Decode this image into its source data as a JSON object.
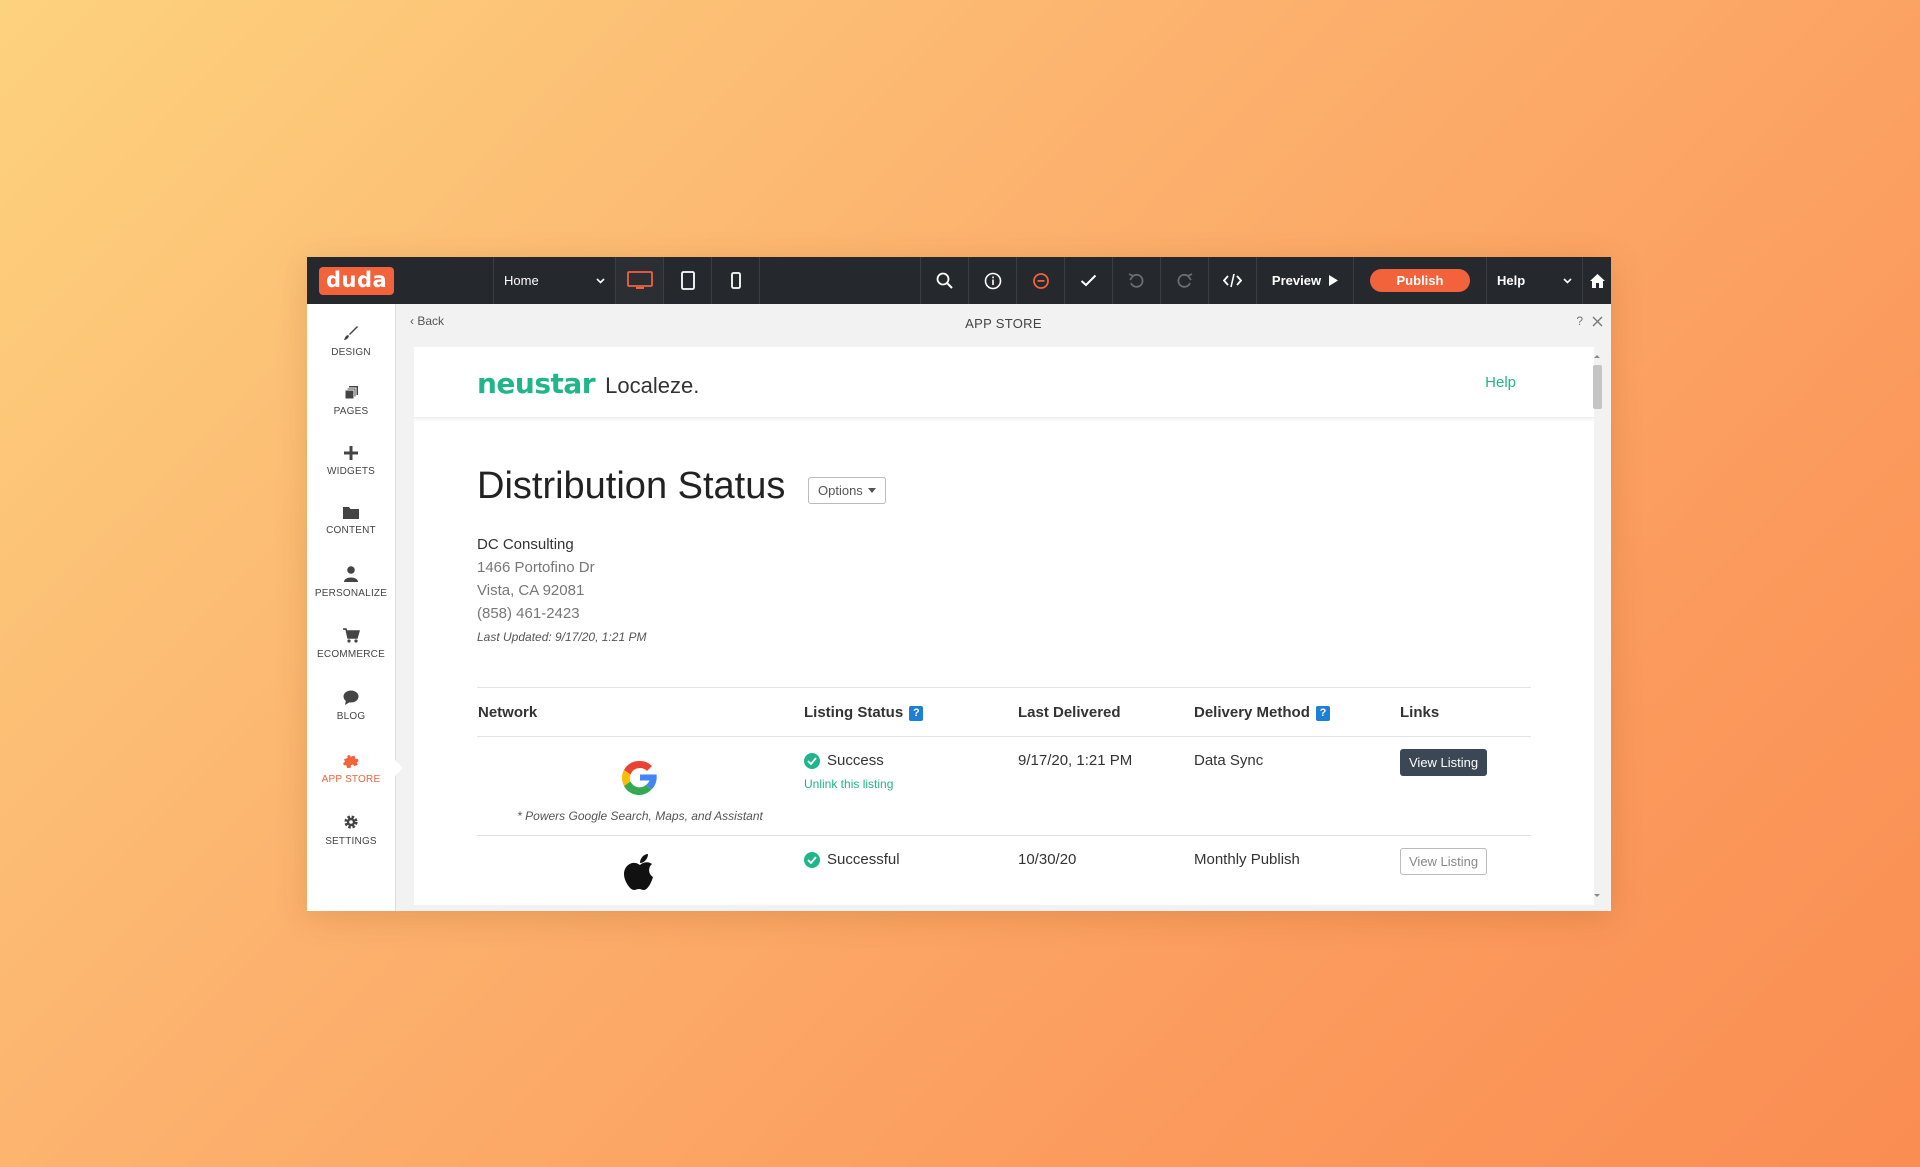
{
  "app": {
    "logo": "duda",
    "page_select": "Home",
    "toolbar": {
      "preview_label": "Preview",
      "publish_label": "Publish",
      "help_label": "Help"
    }
  },
  "sidebar": {
    "items": [
      {
        "label": "DESIGN",
        "icon": "brush-icon"
      },
      {
        "label": "PAGES",
        "icon": "pages-icon"
      },
      {
        "label": "WIDGETS",
        "icon": "plus-icon"
      },
      {
        "label": "CONTENT",
        "icon": "folder-icon"
      },
      {
        "label": "PERSONALIZE",
        "icon": "person-icon"
      },
      {
        "label": "ECOMMERCE",
        "icon": "cart-icon"
      },
      {
        "label": "BLOG",
        "icon": "chat-bubble-icon"
      },
      {
        "label": "APP STORE",
        "icon": "puzzle-icon",
        "active": true
      },
      {
        "label": "SETTINGS",
        "icon": "gear-icon"
      }
    ]
  },
  "panel": {
    "back_label": "Back",
    "title": "APP STORE",
    "help_mark": "?"
  },
  "app_content": {
    "brand_primary": "neustar",
    "brand_secondary": "Localeze.",
    "help_link": "Help",
    "heading": "Distribution Status",
    "options_label": "Options",
    "business": {
      "name": "DC Consulting",
      "street": "1466 Portofino Dr",
      "city": "Vista, CA 92081",
      "phone": "(858) 461-2423",
      "last_updated": "Last Updated: 9/17/20, 1:21 PM"
    },
    "table": {
      "headers": {
        "network": "Network",
        "listing_status": "Listing Status",
        "last_delivered": "Last Delivered",
        "delivery_method": "Delivery Method",
        "links": "Links"
      },
      "help_mark": "?",
      "rows": [
        {
          "network": "google-logo",
          "note": "* Powers Google Search, Maps, and Assistant",
          "status": "Success",
          "action": "Unlink this listing",
          "last_delivered": "9/17/20, 1:21 PM",
          "method": "Data Sync",
          "link": "View Listing"
        },
        {
          "network": "apple-logo",
          "status": "Successful",
          "last_delivered": "10/30/20",
          "method": "Monthly Publish",
          "link": "View Listing"
        }
      ]
    }
  },
  "colors": {
    "accent_orange": "#f2623b",
    "brand_green": "#20b58a",
    "topbar": "#25282d",
    "help_blue": "#1e7fd6"
  }
}
